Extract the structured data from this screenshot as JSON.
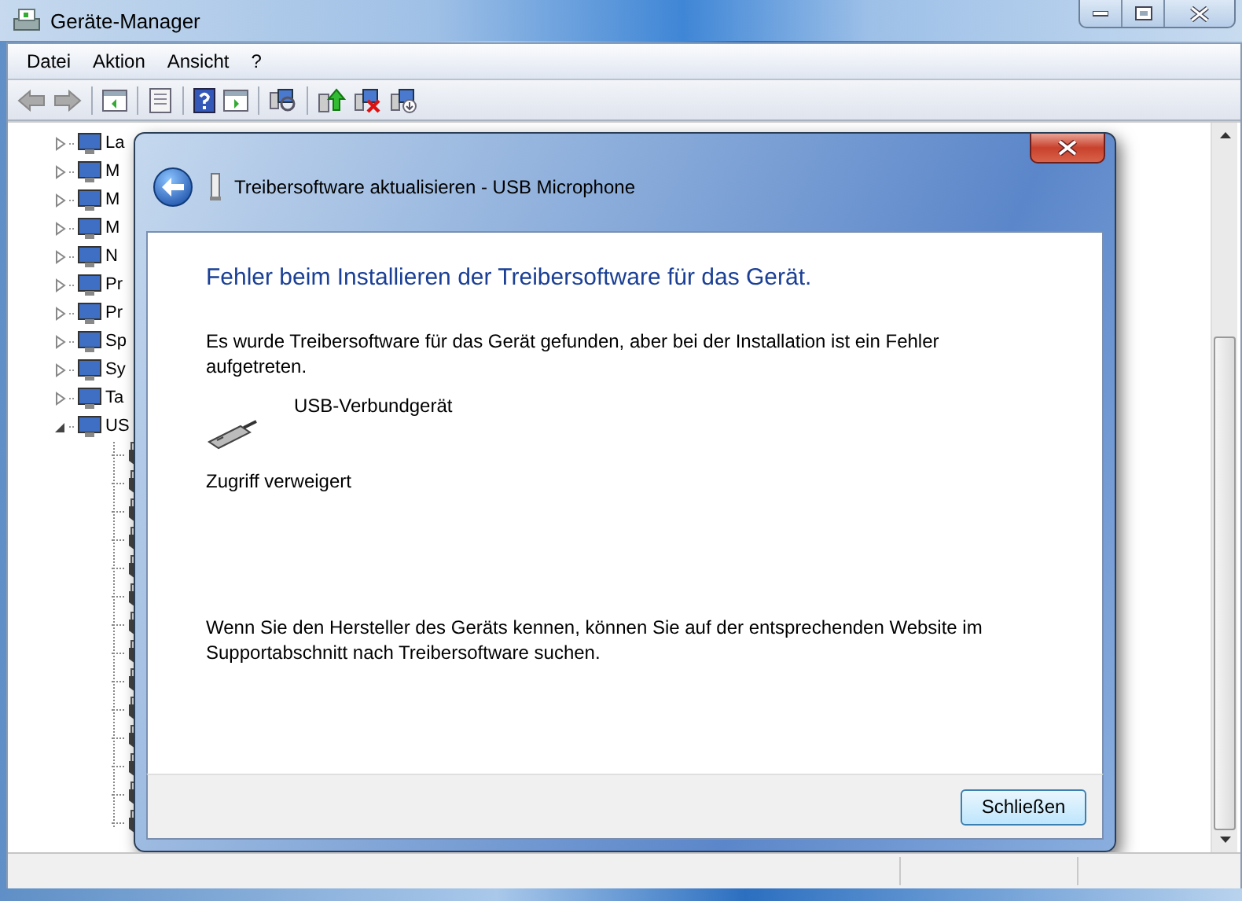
{
  "window": {
    "title": "Geräte-Manager"
  },
  "menu": [
    "Datei",
    "Aktion",
    "Ansicht",
    "?"
  ],
  "tree": [
    {
      "label": "La",
      "expanded": false
    },
    {
      "label": "M",
      "expanded": false
    },
    {
      "label": "M",
      "expanded": false
    },
    {
      "label": "M",
      "expanded": false
    },
    {
      "label": "N",
      "expanded": false
    },
    {
      "label": "Pr",
      "expanded": false
    },
    {
      "label": "Pr",
      "expanded": false
    },
    {
      "label": "Sp",
      "expanded": false
    },
    {
      "label": "Sy",
      "expanded": false
    },
    {
      "label": "Ta",
      "expanded": false
    },
    {
      "label": "US",
      "expanded": true,
      "children": [
        {
          "kind": "device"
        },
        {
          "kind": "device"
        },
        {
          "kind": "device"
        },
        {
          "kind": "device"
        },
        {
          "kind": "device"
        },
        {
          "kind": "device"
        },
        {
          "kind": "device"
        },
        {
          "kind": "device"
        },
        {
          "kind": "device"
        },
        {
          "kind": "device"
        },
        {
          "kind": "device"
        },
        {
          "kind": "device"
        },
        {
          "kind": "device"
        },
        {
          "kind": "device"
        }
      ]
    }
  ],
  "dialog": {
    "title": "Treibersoftware aktualisieren - USB Microphone",
    "heading": "Fehler beim Installieren der Treibersoftware für das Gerät.",
    "message": "Es wurde Treibersoftware für das Gerät gefunden, aber bei der Installation ist ein Fehler aufgetreten.",
    "device": "USB-Verbundgerät",
    "error": "Zugriff verweigert",
    "hint": "Wenn Sie den Hersteller des Geräts kennen, können Sie auf der entsprechenden Website im Supportabschnitt nach Treibersoftware suchen.",
    "button": "Schließen"
  }
}
